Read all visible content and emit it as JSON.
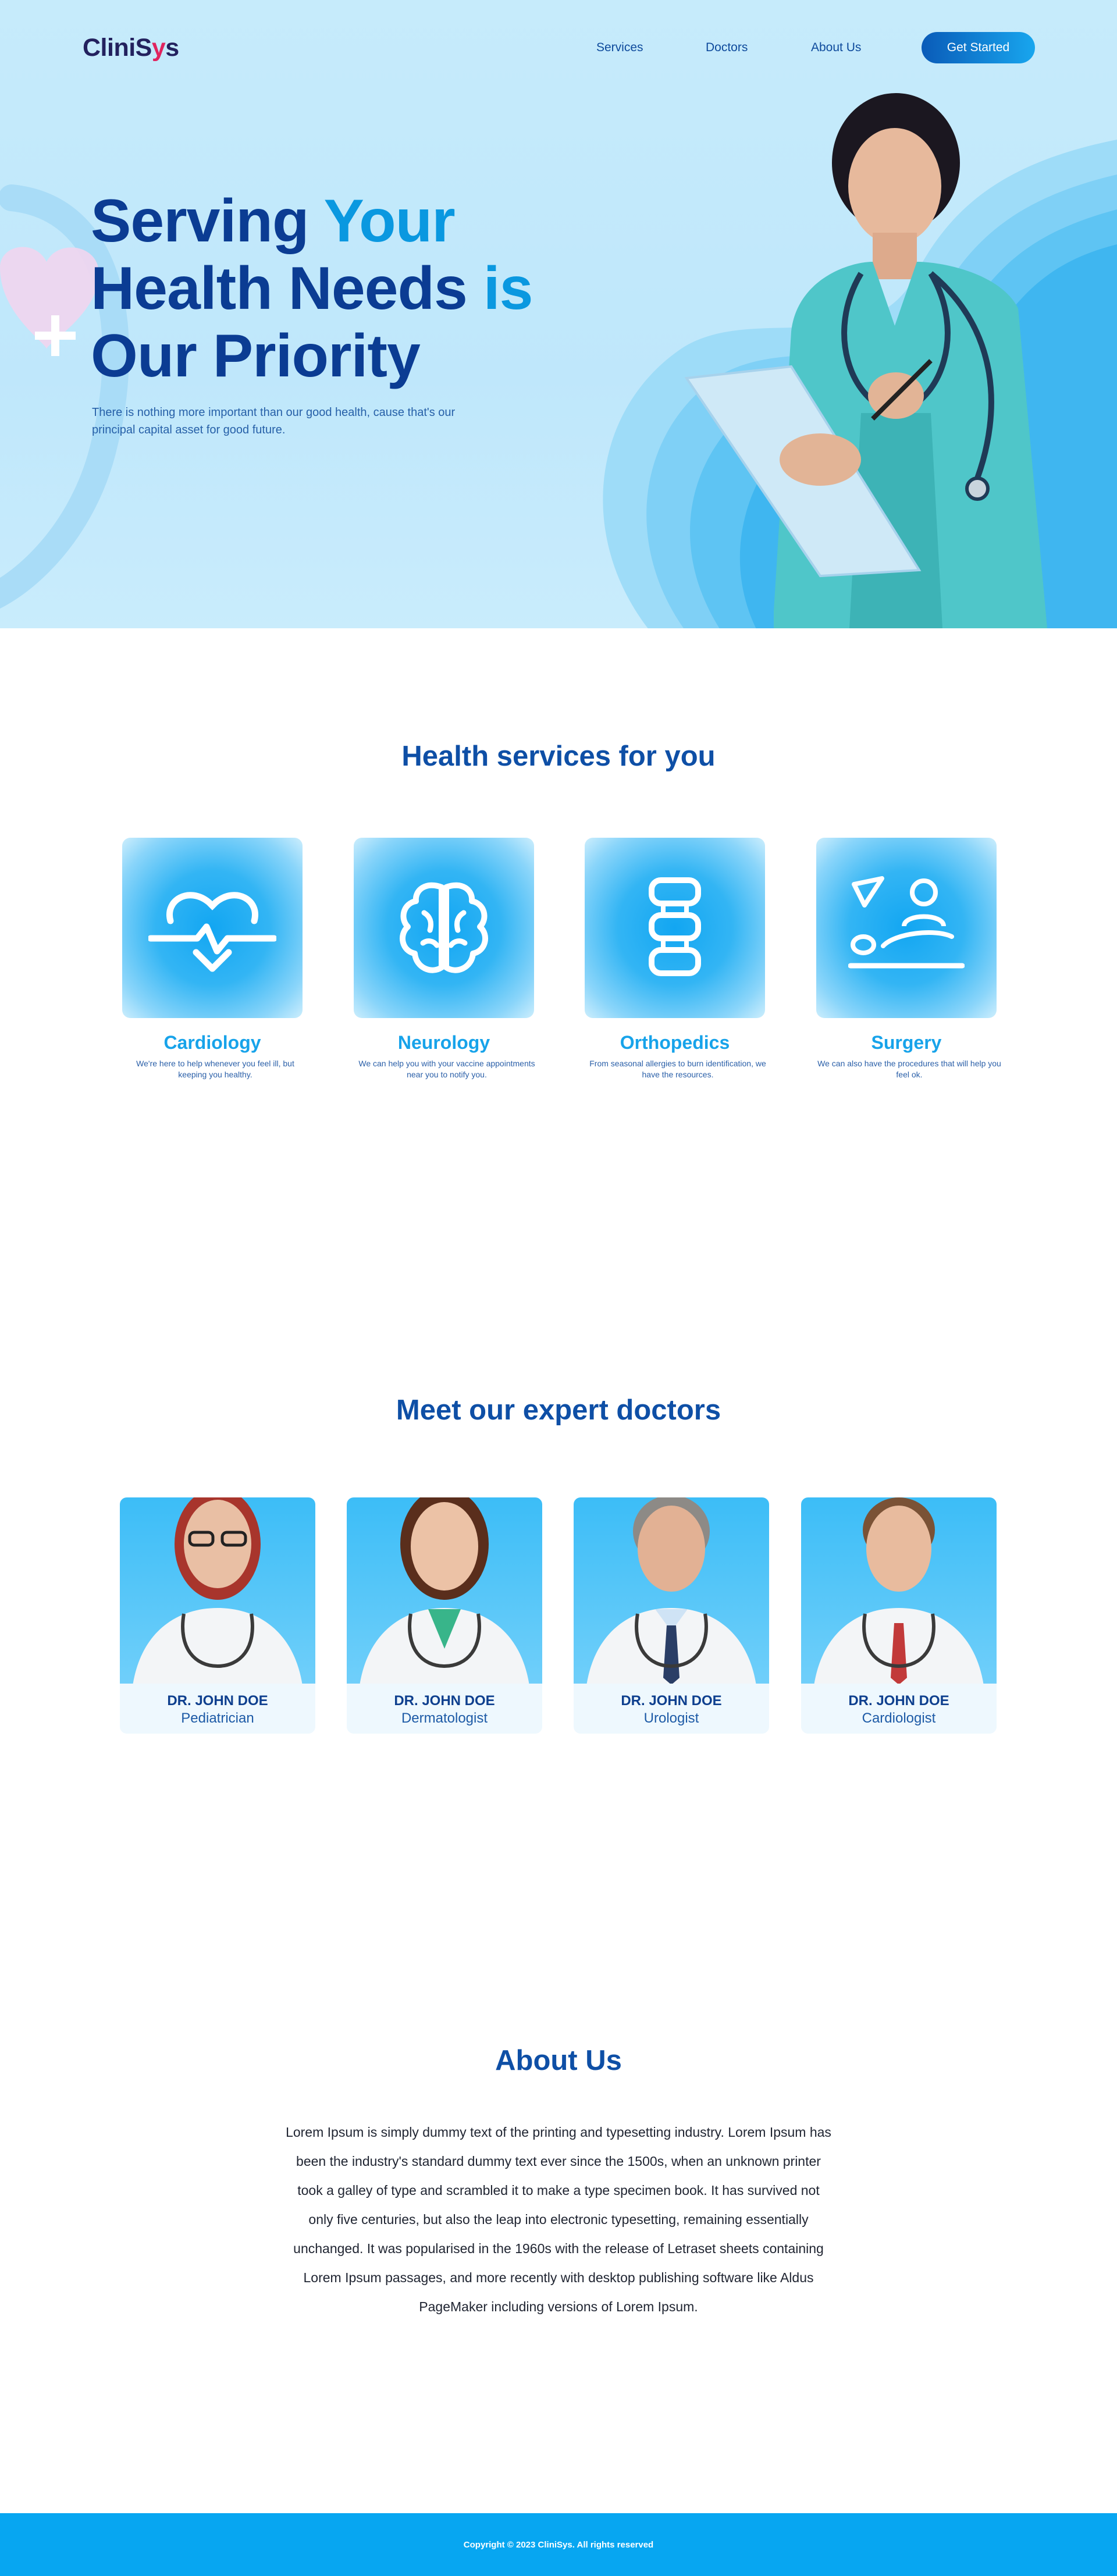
{
  "brand": {
    "name_part1": "CliniS",
    "name_part2": "y",
    "name_part3": "s"
  },
  "nav": {
    "services": "Services",
    "doctors": "Doctors",
    "about": "About Us",
    "cta": "Get Started"
  },
  "hero": {
    "title_line1_a": "Serving ",
    "title_line1_b": "Your",
    "title_line2_a": "Health Needs ",
    "title_line2_b": "is",
    "title_line3": "Our Priority",
    "subtitle": "There is nothing more important than our good health, cause that's our principal capital asset for good future."
  },
  "services": {
    "title": "Health services for you",
    "items": [
      {
        "name": "Cardiology",
        "desc": "We're here to help whenever you feel ill, but keeping you healthy.",
        "icon": "heart-pulse-icon"
      },
      {
        "name": "Neurology",
        "desc": "We can help you with your vaccine appointments near you to notify you.",
        "icon": "brain-icon"
      },
      {
        "name": "Orthopedics",
        "desc": "From seasonal allergies to burn identification, we have the resources.",
        "icon": "spine-icon"
      },
      {
        "name": "Surgery",
        "desc": "We can also have the procedures that will help you feel ok.",
        "icon": "surgery-icon"
      }
    ]
  },
  "doctors": {
    "title": "Meet our expert doctors",
    "items": [
      {
        "name": "DR. JOHN DOE",
        "role": "Pediatrician"
      },
      {
        "name": "DR. JOHN DOE",
        "role": "Dermatologist"
      },
      {
        "name": "DR. JOHN DOE",
        "role": "Urologist"
      },
      {
        "name": "DR. JOHN DOE",
        "role": "Cardiologist"
      }
    ]
  },
  "about": {
    "title": "About Us",
    "text": "Lorem Ipsum is simply dummy text of the printing and typesetting industry. Lorem Ipsum has been the industry's standard dummy text ever since the 1500s, when an unknown printer took a galley of type and scrambled it to make a type specimen book. It has survived not only five centuries, but also the leap into electronic typesetting, remaining essentially unchanged. It was popularised in the 1960s with the release of Letraset sheets containing Lorem Ipsum passages, and more recently with desktop publishing software like Aldus PageMaker including versions of Lorem Ipsum."
  },
  "footer": {
    "copyright": "Copyright © 2023 CliniSys. All rights reserved"
  },
  "colors": {
    "primary_dark": "#0b3c93",
    "accent": "#0a98e0",
    "footer_bg": "#07a6f1"
  }
}
